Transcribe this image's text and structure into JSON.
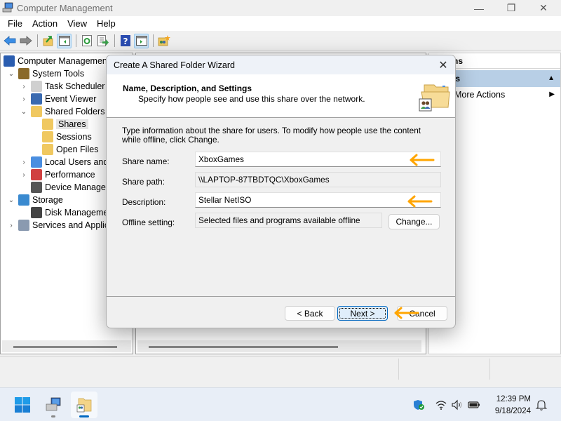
{
  "window": {
    "title": "Computer Management",
    "controls": {
      "minimize": "—",
      "maximize": "❐",
      "close": "✕"
    }
  },
  "menu": [
    "File",
    "Action",
    "View",
    "Help"
  ],
  "toolbar": {
    "buttons": [
      "back-icon",
      "forward-icon",
      "up-folder-icon",
      "show-hide-console-tree-icon",
      "refresh-icon",
      "export-list-icon",
      "help-icon",
      "show-hide-action-pane-icon",
      "new-share-icon"
    ]
  },
  "tree": {
    "items": [
      {
        "label": "Computer Management",
        "expander": "",
        "icon": "computer-management-icon",
        "level": 0
      },
      {
        "label": "System Tools",
        "expander": "⌄",
        "icon": "system-tools-icon",
        "level": 1
      },
      {
        "label": "Task Scheduler",
        "expander": "›",
        "icon": "task-scheduler-icon",
        "level": 2
      },
      {
        "label": "Event Viewer",
        "expander": "›",
        "icon": "event-viewer-icon",
        "level": 2
      },
      {
        "label": "Shared Folders",
        "expander": "⌄",
        "icon": "shared-folders-icon",
        "level": 2
      },
      {
        "label": "Shares",
        "expander": "",
        "icon": "shares-icon",
        "level": 3,
        "selected": true
      },
      {
        "label": "Sessions",
        "expander": "",
        "icon": "sessions-icon",
        "level": 3
      },
      {
        "label": "Open Files",
        "expander": "",
        "icon": "open-files-icon",
        "level": 3
      },
      {
        "label": "Local Users and Groups",
        "expander": "›",
        "icon": "local-users-icon",
        "level": 2
      },
      {
        "label": "Performance",
        "expander": "›",
        "icon": "performance-icon",
        "level": 2
      },
      {
        "label": "Device Manager",
        "expander": "",
        "icon": "device-manager-icon",
        "level": 2
      },
      {
        "label": "Storage",
        "expander": "⌄",
        "icon": "storage-icon",
        "level": 1
      },
      {
        "label": "Disk Management",
        "expander": "",
        "icon": "disk-management-icon",
        "level": 2
      },
      {
        "label": "Services and Applications",
        "expander": "›",
        "icon": "services-icon",
        "level": 1
      }
    ]
  },
  "actions": {
    "header": "Actions",
    "section": "Shares",
    "more": "More Actions"
  },
  "dialog": {
    "title": "Create A Shared Folder Wizard",
    "header_title": "Name, Description, and Settings",
    "header_subtitle": "Specify how people see and use this share over the network.",
    "intro": "Type information about the share for users. To modify how people use the content while offline, click Change.",
    "fields": {
      "share_name": {
        "label": "Share name:",
        "value": "XboxGames"
      },
      "share_path": {
        "label": "Share path:",
        "value": "\\\\LAPTOP-87TBDTQC\\XboxGames"
      },
      "description": {
        "label": "Description:",
        "value": "Stellar NetISO"
      },
      "offline_setting": {
        "label": "Offline setting:",
        "value": "Selected files and programs available offline"
      }
    },
    "buttons": {
      "change": "Change...",
      "back": "< Back",
      "next": "Next >",
      "cancel": "Cancel"
    },
    "annotation_color": "#ffa500"
  },
  "taskbar": {
    "apps": [
      "start-icon",
      "computer-management-app-icon",
      "shared-folder-wizard-app-icon"
    ],
    "tray": [
      "windows-security-icon",
      "wifi-icon",
      "volume-icon",
      "battery-icon"
    ],
    "time": "12:39 PM",
    "date": "9/18/2024"
  }
}
